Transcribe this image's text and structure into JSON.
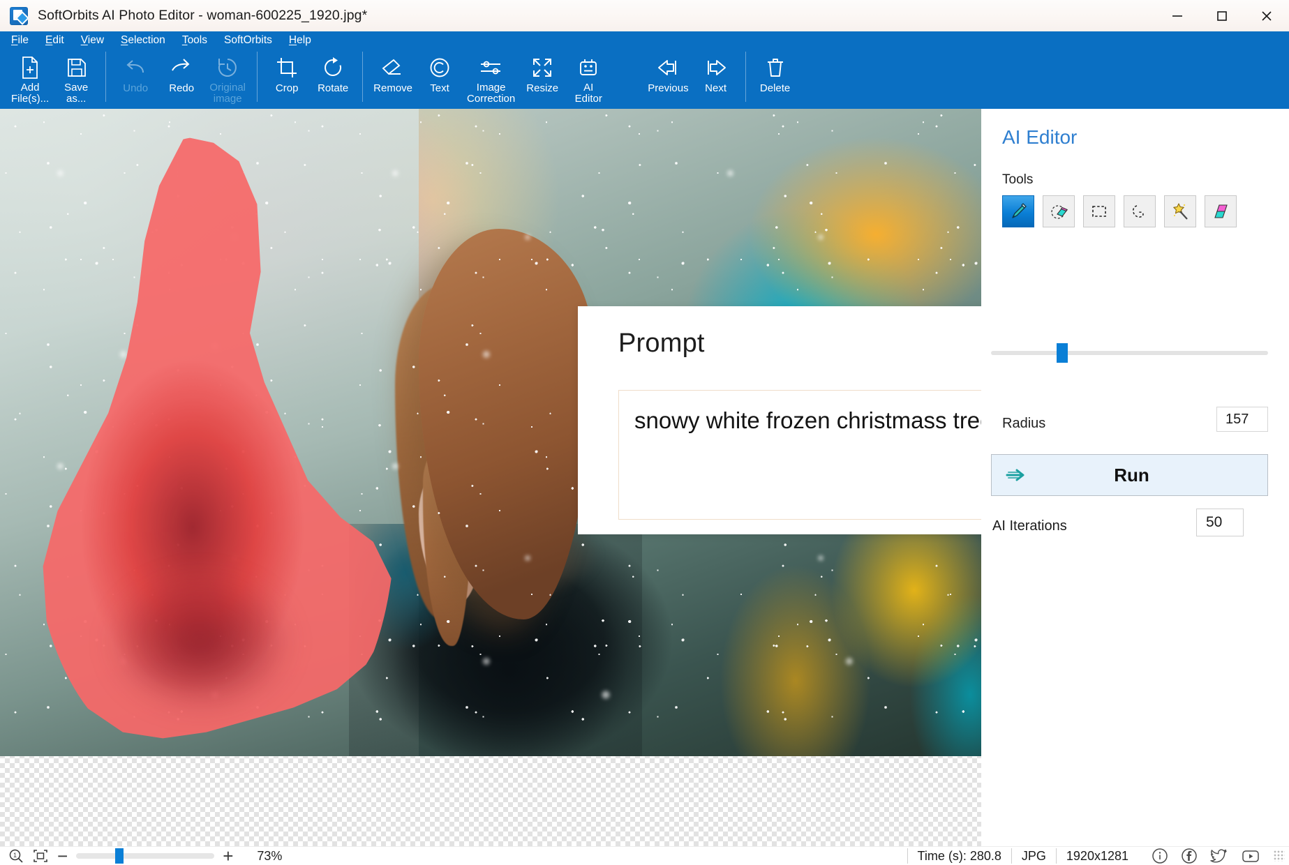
{
  "window": {
    "title": "SoftOrbits AI Photo Editor - woman-600225_1920.jpg*",
    "app_icon": "app-logo-icon",
    "minimize": "minimize-icon",
    "maximize": "maximize-icon",
    "close": "close-icon"
  },
  "menubar": {
    "items": [
      {
        "label": "File",
        "mnemonic": "F"
      },
      {
        "label": "Edit",
        "mnemonic": "E"
      },
      {
        "label": "View",
        "mnemonic": "V"
      },
      {
        "label": "Selection",
        "mnemonic": "S"
      },
      {
        "label": "Tools",
        "mnemonic": "T"
      },
      {
        "label": "SoftOrbits",
        "mnemonic": ""
      },
      {
        "label": "Help",
        "mnemonic": "H"
      }
    ]
  },
  "toolbar": {
    "buttons": [
      {
        "label": "Add\nFile(s)...",
        "icon": "add-file-icon",
        "enabled": true
      },
      {
        "label": "Save\nas...",
        "icon": "save-icon",
        "enabled": true
      },
      {
        "label": "Undo",
        "icon": "undo-icon",
        "enabled": false
      },
      {
        "label": "Redo",
        "icon": "redo-icon",
        "enabled": true
      },
      {
        "label": "Original\nimage",
        "icon": "history-clock-icon",
        "enabled": false
      },
      {
        "label": "Crop",
        "icon": "crop-icon",
        "enabled": true
      },
      {
        "label": "Rotate",
        "icon": "rotate-cw-icon",
        "enabled": true
      },
      {
        "label": "Remove",
        "icon": "eraser-icon",
        "enabled": true
      },
      {
        "label": "Text",
        "icon": "copyright-text-icon",
        "enabled": true
      },
      {
        "label": "Image\nCorrection",
        "icon": "sliders-icon",
        "enabled": true
      },
      {
        "label": "Resize",
        "icon": "resize-arrows-icon",
        "enabled": true
      },
      {
        "label": "AI\nEditor",
        "icon": "ai-robot-icon",
        "enabled": true
      },
      {
        "label": "Previous",
        "icon": "arrow-left-icon",
        "enabled": true
      },
      {
        "label": "Next",
        "icon": "arrow-right-icon",
        "enabled": true
      },
      {
        "label": "Delete",
        "icon": "trash-icon",
        "enabled": true
      }
    ]
  },
  "prompt_panel": {
    "title": "Prompt",
    "value": "snowy white frozen christmass tree",
    "placeholder": "",
    "scroll_up": "scroll-up-arrow-icon",
    "scroll_down": "scroll-down-arrow-icon"
  },
  "ai_editor": {
    "title": "AI Editor",
    "tools_label": "Tools",
    "tools": [
      {
        "name": "brush-tool",
        "icon": "brush-icon",
        "selected": true
      },
      {
        "name": "eraser-tool",
        "icon": "mask-eraser-icon",
        "selected": false
      },
      {
        "name": "rectangle-select",
        "icon": "marquee-rect-icon",
        "selected": false
      },
      {
        "name": "lasso-select",
        "icon": "lasso-icon",
        "selected": false
      },
      {
        "name": "magic-wand",
        "icon": "magic-wand-icon",
        "selected": false
      },
      {
        "name": "gradient-fill",
        "icon": "gradient-shape-icon",
        "selected": false
      }
    ],
    "radius_label": "Radius",
    "radius_value": "157",
    "radius_percent": 24,
    "run_label": "Run",
    "run_icon": "run-arrow-icon",
    "iterations_label": "AI Iterations",
    "iterations_value": "50",
    "accent_color": "#0a7fd6",
    "title_color": "#2f7fd0"
  },
  "statusbar": {
    "zoom_icon": "zoom-one-to-one-icon",
    "fit_icon": "fit-to-window-icon",
    "zoom_out": "−",
    "zoom_in": "+",
    "zoom_percent": "73%",
    "zoom_slider_percent": 29,
    "time": "Time (s): 280.8",
    "format": "JPG",
    "dimensions": "1920x1281",
    "social": [
      {
        "name": "info-icon"
      },
      {
        "name": "facebook-icon"
      },
      {
        "name": "twitter-icon"
      },
      {
        "name": "youtube-icon"
      }
    ]
  },
  "canvas": {
    "mask_color": "#f77070",
    "image_name": "woman-600225_1920.jpg"
  }
}
